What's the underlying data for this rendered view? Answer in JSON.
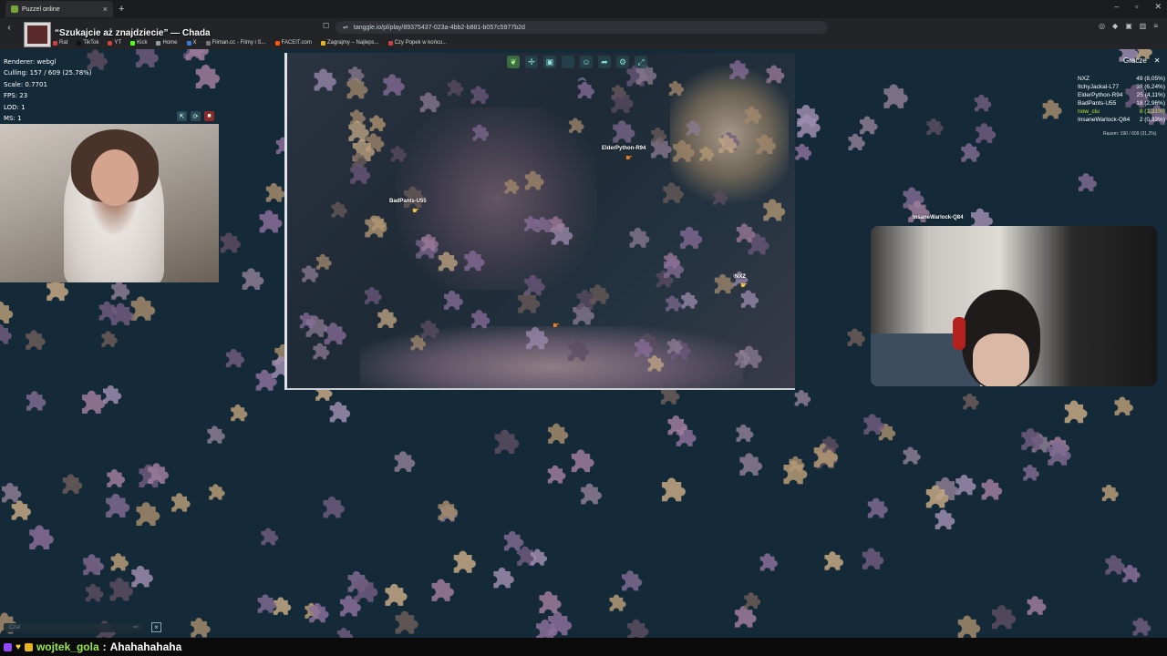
{
  "browser": {
    "tab_title": "Puzzel online",
    "url": "tanggle.io/pl/play/89375437-023a-4bb2-b881-b057c5977b2d",
    "bookmarks": [
      "Rat",
      "TikTok",
      "YT",
      "Kick",
      "Home",
      "X",
      "Filman.cc - Filmy i S...",
      "FACEIT.com",
      "Zagrajmy – Najleps...",
      "Czy Popek w końcu..."
    ]
  },
  "stream": {
    "title": "“Szukajcie aż znajdziecie” — Chada"
  },
  "debug": {
    "renderer": "Renderer: webgl",
    "culling": "Culling: 157 / 609 (25.78%)",
    "scale": "Scale: 0.7701",
    "fps": "FPS: 23",
    "lod": "LOD: 1",
    "ms": "MS: 1"
  },
  "players_panel": {
    "title": "Gracze",
    "players": [
      {
        "name": "NXZ",
        "score": "49 (8,05%)"
      },
      {
        "name": "ItchyJackal-L77",
        "score": "38 (6,24%)"
      },
      {
        "name": "ElderPython-R94",
        "score": "25 (4,11%)"
      },
      {
        "name": "BadPants-U55",
        "score": "18 (2,96%)"
      },
      {
        "name": "now_ciu",
        "score": "8 (1,31%)"
      },
      {
        "name": "InsaneWarlock-Q84",
        "score": "2 (0,33%)"
      }
    ],
    "total": "Razem: 190 / 609 (31,2%)"
  },
  "cursors": {
    "elder": "ElderPython-R94",
    "badpants": "BadPants-U55",
    "nxz": "NXZ",
    "insane": "InsaneWarlock-Q84"
  },
  "chat": {
    "placeholder": "Czat",
    "user": "wojtek_gola",
    "separator": ":",
    "message": "Ahahahahaha"
  },
  "colors": {
    "background": "#142a38",
    "self_player": "#c0e23a",
    "chat_user": "#9ae64b"
  }
}
